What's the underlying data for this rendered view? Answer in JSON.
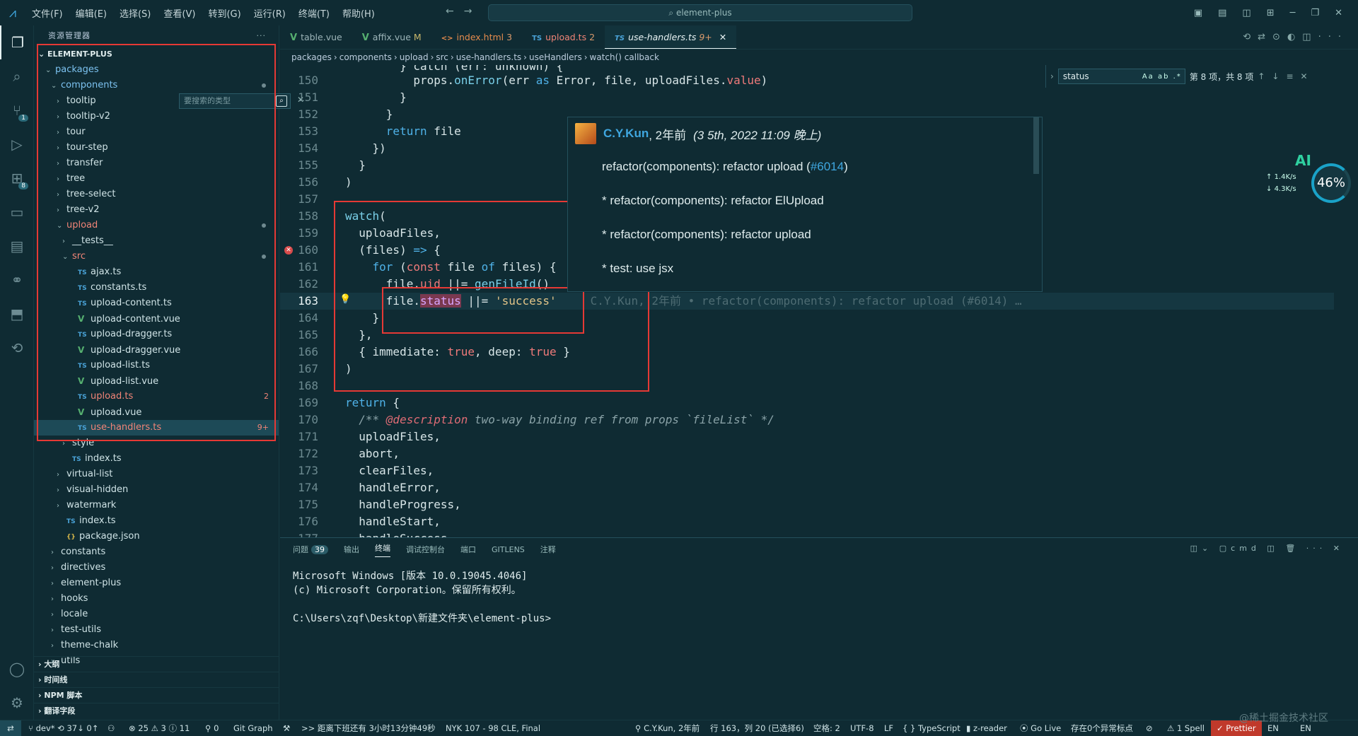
{
  "titlebar": {
    "menu": [
      "文件(F)",
      "编辑(E)",
      "选择(S)",
      "查看(V)",
      "转到(G)",
      "运行(R)",
      "终端(T)",
      "帮助(H)"
    ],
    "search": "element-plus"
  },
  "activity": {
    "scm_badge": "1",
    "ext_badge": "8"
  },
  "sidebar": {
    "title": "资源管理器",
    "root": "ELEMENT-PLUS",
    "search_placeholder": "要搜索的类型",
    "items": [
      {
        "label": "packages",
        "indent": 0,
        "kind": "folder-open",
        "color": "blue"
      },
      {
        "label": "components",
        "indent": 1,
        "kind": "folder-open",
        "color": "blue",
        "dot": true
      },
      {
        "label": "tooltip",
        "indent": 2,
        "kind": "folder"
      },
      {
        "label": "tooltip-v2",
        "indent": 2,
        "kind": "folder"
      },
      {
        "label": "tour",
        "indent": 2,
        "kind": "folder"
      },
      {
        "label": "tour-step",
        "indent": 2,
        "kind": "folder"
      },
      {
        "label": "transfer",
        "indent": 2,
        "kind": "folder"
      },
      {
        "label": "tree",
        "indent": 2,
        "kind": "folder"
      },
      {
        "label": "tree-select",
        "indent": 2,
        "kind": "folder"
      },
      {
        "label": "tree-v2",
        "indent": 2,
        "kind": "folder"
      },
      {
        "label": "upload",
        "indent": 2,
        "kind": "folder-open",
        "color": "red",
        "dot": true
      },
      {
        "label": "__tests__",
        "indent": 3,
        "kind": "folder"
      },
      {
        "label": "src",
        "indent": 3,
        "kind": "folder-open",
        "color": "red",
        "dot": true
      },
      {
        "label": "ajax.ts",
        "indent": 4,
        "kind": "ts"
      },
      {
        "label": "constants.ts",
        "indent": 4,
        "kind": "ts"
      },
      {
        "label": "upload-content.ts",
        "indent": 4,
        "kind": "ts"
      },
      {
        "label": "upload-content.vue",
        "indent": 4,
        "kind": "vue"
      },
      {
        "label": "upload-dragger.ts",
        "indent": 4,
        "kind": "ts"
      },
      {
        "label": "upload-dragger.vue",
        "indent": 4,
        "kind": "vue"
      },
      {
        "label": "upload-list.ts",
        "indent": 4,
        "kind": "ts"
      },
      {
        "label": "upload-list.vue",
        "indent": 4,
        "kind": "vue"
      },
      {
        "label": "upload.ts",
        "indent": 4,
        "kind": "ts",
        "color": "red",
        "badge": "2"
      },
      {
        "label": "upload.vue",
        "indent": 4,
        "kind": "vue"
      },
      {
        "label": "use-handlers.ts",
        "indent": 4,
        "kind": "ts",
        "color": "red",
        "badge": "9+",
        "selected": true
      },
      {
        "label": "style",
        "indent": 3,
        "kind": "folder"
      },
      {
        "label": "index.ts",
        "indent": 3,
        "kind": "ts"
      },
      {
        "label": "virtual-list",
        "indent": 2,
        "kind": "folder"
      },
      {
        "label": "visual-hidden",
        "indent": 2,
        "kind": "folder"
      },
      {
        "label": "watermark",
        "indent": 2,
        "kind": "folder"
      },
      {
        "label": "index.ts",
        "indent": 2,
        "kind": "ts"
      },
      {
        "label": "package.json",
        "indent": 2,
        "kind": "json"
      },
      {
        "label": "constants",
        "indent": 1,
        "kind": "folder"
      },
      {
        "label": "directives",
        "indent": 1,
        "kind": "folder"
      },
      {
        "label": "element-plus",
        "indent": 1,
        "kind": "folder"
      },
      {
        "label": "hooks",
        "indent": 1,
        "kind": "folder"
      },
      {
        "label": "locale",
        "indent": 1,
        "kind": "folder"
      },
      {
        "label": "test-utils",
        "indent": 1,
        "kind": "folder"
      },
      {
        "label": "theme-chalk",
        "indent": 1,
        "kind": "folder"
      },
      {
        "label": "utils",
        "indent": 1,
        "kind": "folder"
      }
    ],
    "sections": [
      "大纲",
      "时间线",
      "NPM 脚本",
      "翻译字段"
    ]
  },
  "tabs": [
    {
      "label": "table.vue",
      "icon": "vue"
    },
    {
      "label": "affix.vue",
      "icon": "vue",
      "suffix": "M"
    },
    {
      "label": "index.html",
      "icon": "html",
      "suffix": "3"
    },
    {
      "label": "upload.ts",
      "icon": "ts",
      "suffix": "2"
    },
    {
      "label": "use-handlers.ts",
      "icon": "ts",
      "suffix": "9+",
      "active": true
    }
  ],
  "breadcrumb": [
    "packages",
    "components",
    "upload",
    "src",
    "use-handlers.ts",
    "useHandlers",
    "watch() callback"
  ],
  "editor": {
    "blame": "C.Y.Kun, 2年前 • refactor(components): refactor upload (#6014) …"
  },
  "hover": {
    "author": "C.Y.Kun",
    "ago": ", 2年前",
    "date": "(3 5th, 2022 11:09 晚上)",
    "msg1_pre": "refactor(components): refactor upload (",
    "msg1_link": "#6014",
    "msg1_post": ")",
    "msg2": "* refactor(components): refactor ElUpload",
    "msg3": "* refactor(components): refactor upload",
    "msg4": "* test: use jsx"
  },
  "find": {
    "value": "status",
    "count": "第 8 项，共 8 项",
    "opts": "Aa ab .*"
  },
  "net": {
    "ai": "AI",
    "up": "1.4K/s",
    "down": "4.3K/s",
    "pct": "46%"
  },
  "panel": {
    "tabs": [
      {
        "label": "问题",
        "badge": "39"
      },
      {
        "label": "输出"
      },
      {
        "label": "终端",
        "active": true
      },
      {
        "label": "调试控制台"
      },
      {
        "label": "端口"
      },
      {
        "label": "GITLENS"
      },
      {
        "label": "注释"
      }
    ],
    "shell": "cmd",
    "terminal": "Microsoft Windows [版本 10.0.19045.4046]\n(c) Microsoft Corporation。保留所有权利。\n\nC:\\Users\\zqf\\Desktop\\新建文件夹\\element-plus>"
  },
  "status": {
    "branch": "dev*",
    "sync": "37↓ 0↑",
    "problems": "⊗ 25 ⚠ 3 ⓘ 11",
    "ports": "⚲ 0",
    "gitgraph": "Git Graph",
    "countdown": ">> 距离下班还有 3小时13分钟49秒",
    "nyk": "NYK 107 - 98 CLE, Final",
    "blame": "C.Y.Kun, 2年前",
    "pos": "行 163，列 20 (已选择6)",
    "spaces": "空格: 2",
    "enc": "UTF-8",
    "eol": "LF",
    "lang": "{ } TypeScript",
    "zreader": "z-reader",
    "golive": "Go Live",
    "abnormal": "存在0个异常标点",
    "spell": "⚠ 1 Spell",
    "prettier": "✓ Prettier",
    "en1": "EN",
    "en2": "EN",
    "watermark": "@稀土掘金技术社区"
  }
}
